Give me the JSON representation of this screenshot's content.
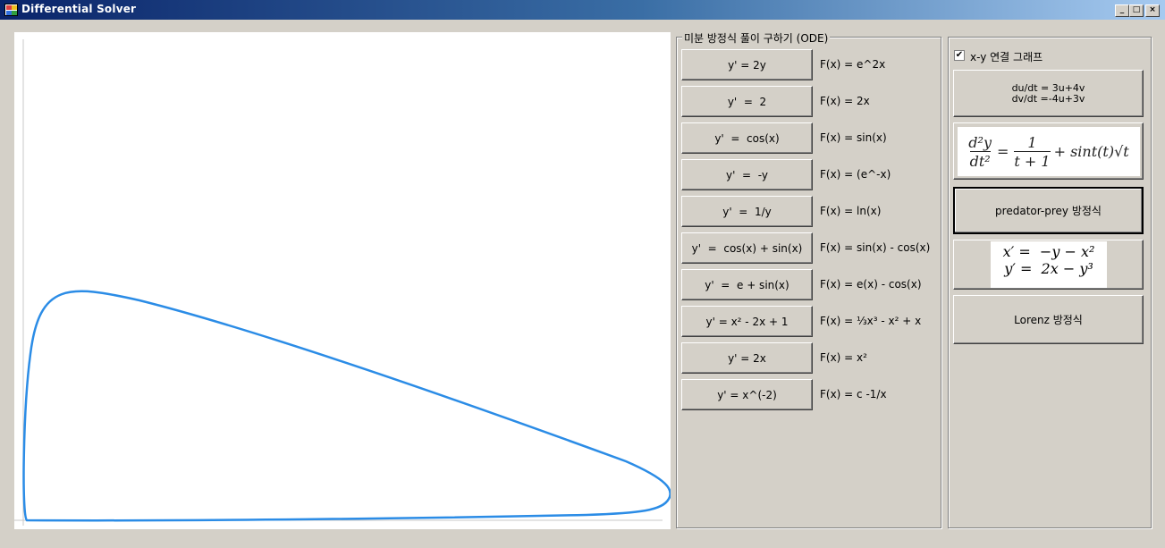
{
  "window": {
    "title": "Differential Solver",
    "controls": [
      "_",
      "□",
      "×"
    ]
  },
  "ode_group": {
    "legend": "미분 방정식 풀이 구하기 (ODE)",
    "rows": [
      {
        "button": "y' = 2y",
        "solution": "F(x) = e^2x"
      },
      {
        "button": "y'  =  2",
        "solution": "F(x) = 2x"
      },
      {
        "button": "y'  =  cos(x)",
        "solution": "F(x) = sin(x)"
      },
      {
        "button": "y'  =  -y",
        "solution": "F(x) = (e^-x)"
      },
      {
        "button": "y'  =  1/y",
        "solution": "F(x) = ln(x)"
      },
      {
        "button": "y'  =  cos(x) + sin(x)",
        "solution": "F(x) = sin(x) - cos(x)"
      },
      {
        "button": "y'  =  e + sin(x)",
        "solution": "F(x) = e(x) - cos(x)"
      },
      {
        "button": "y' = x² - 2x + 1",
        "solution": "F(x) = ⅓x³ - x² + x"
      },
      {
        "button": "y' = 2x",
        "solution": "F(x) = x²"
      },
      {
        "button": "y' = x^(-2)",
        "solution": "F(x) = c  -1/x"
      }
    ]
  },
  "system_group": {
    "checkbox_label": "x-y 연결 그래프",
    "checkbox_checked": true,
    "linear_system": {
      "line1": "du/dt = 3u+4v",
      "line2": "dv/dt =-4u+3v"
    },
    "second_order": {
      "num": "d²y",
      "den": "dt²",
      "rhs_frac_num": "1",
      "rhs_frac_den": "t + 1",
      "rhs_rest": "+ sint(t)√t"
    },
    "predator_prey_label": "predator-prey 방정식",
    "nonlinear_system": {
      "line1_lhs": "x′ =",
      "line1_rhs": "−y − x²",
      "line2_lhs": "y′ =",
      "line2_rhs": "2x − y³"
    },
    "lorenz_label": "Lorenz 방정식"
  },
  "plot": {
    "curve_color": "#2b8ce6",
    "axis_color": "#c8c8c8"
  }
}
